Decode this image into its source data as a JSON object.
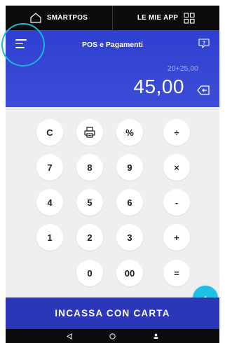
{
  "topbar": {
    "smartpos_label": "SMARTPOS",
    "apps_label": "LE MIE APP"
  },
  "header": {
    "title": "POS e Pagamenti",
    "expression": "20+25,00",
    "amount": "45,00"
  },
  "keypad": {
    "keys": {
      "clear": "C",
      "percent": "%",
      "divide": "÷",
      "seven": "7",
      "eight": "8",
      "nine": "9",
      "multiply": "×",
      "four": "4",
      "five": "5",
      "six": "6",
      "minus": "-",
      "one": "1",
      "two": "2",
      "three": "3",
      "plus": "+",
      "zero": "0",
      "double_zero": "00",
      "equals": "="
    }
  },
  "footer": {
    "charge_label": "INCASSA CON CARTA"
  },
  "colors": {
    "header_blue": "#3c4ed8",
    "charge_blue": "#2b36b8",
    "accent_cyan": "#1ec0e6",
    "keypad_bg": "#efefef"
  },
  "icons": [
    "home-icon",
    "grid-icon",
    "menu-icon",
    "help-chat-icon",
    "backspace-icon",
    "printer-icon",
    "chevron-up-icon",
    "back-icon",
    "home-circle-icon",
    "person-icon"
  ]
}
